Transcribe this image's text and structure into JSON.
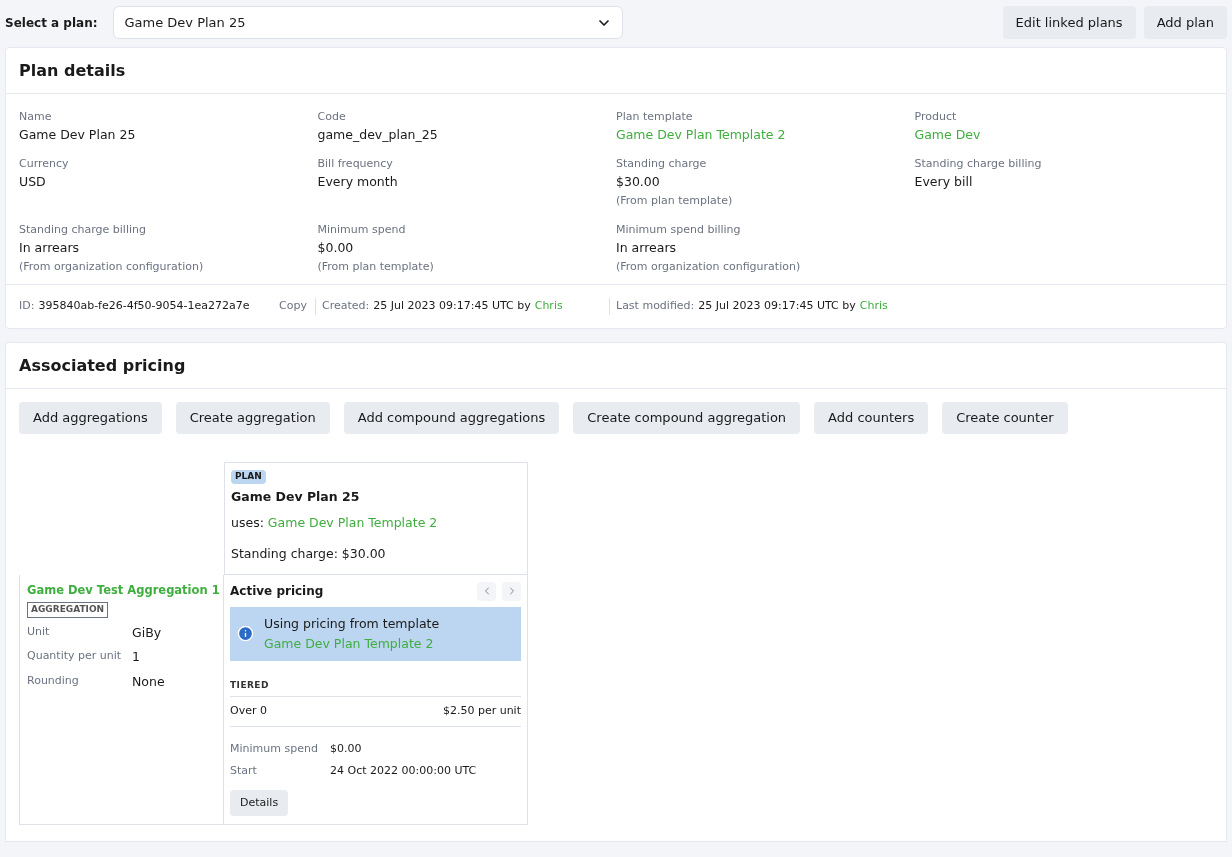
{
  "plan_select": {
    "label": "Select a plan:",
    "value": "Game Dev Plan 25"
  },
  "header_buttons": [
    "Edit linked plans",
    "Add plan"
  ],
  "plan_details": {
    "title": "Plan details",
    "fields": [
      {
        "label": "Name",
        "value": "Game Dev Plan 25",
        "link": false
      },
      {
        "label": "Code",
        "value": "game_dev_plan_25",
        "link": false
      },
      {
        "label": "Plan template",
        "value": "Game Dev Plan Template 2",
        "link": true
      },
      {
        "label": "Product",
        "value": "Game Dev",
        "link": true
      },
      {
        "label": "Currency",
        "value": "USD",
        "link": false
      },
      {
        "label": "Bill frequency",
        "value": "Every month",
        "link": false
      },
      {
        "label": "Standing charge",
        "value": "$30.00",
        "note": "(From plan template)",
        "link": false
      },
      {
        "label": "Standing charge billing",
        "value": "Every bill",
        "link": false
      },
      {
        "label": "Standing charge billing",
        "value": "In arrears",
        "note": "(From organization configuration)",
        "link": false
      },
      {
        "label": "Minimum spend",
        "value": "$0.00",
        "note": "(From plan template)",
        "link": false
      },
      {
        "label": "Minimum spend billing",
        "value": "In arrears",
        "note": "(From organization configuration)",
        "link": false
      }
    ],
    "footer": {
      "id_label": "ID:",
      "id": "395840ab-fe26-4f50-9054-1ea272a7e",
      "copy": "Copy",
      "created_label": "Created:",
      "created": "25 Jul 2023 09:17:45 UTC by",
      "created_by": "Chris",
      "modified_label": "Last modified:",
      "modified": "25 Jul 2023 09:17:45 UTC by",
      "modified_by": "Chris"
    }
  },
  "associated_pricing": {
    "title": "Associated pricing",
    "buttons": [
      "Add aggregations",
      "Create aggregation",
      "Add compound aggregations",
      "Create compound aggregation",
      "Add counters",
      "Create counter"
    ],
    "plan": {
      "badge": "PLAN",
      "name": "Game Dev Plan 25",
      "uses_label": "uses:",
      "uses": "Game Dev Plan Template 2",
      "standing_charge": "Standing charge: $30.00"
    },
    "aggregation": {
      "name": "Game Dev Test Aggregation 1",
      "badge": "AGGREGATION",
      "props": [
        {
          "label": "Unit",
          "value": "GiBy"
        },
        {
          "label": "Quantity per unit",
          "value": "1"
        },
        {
          "label": "Rounding",
          "value": "None"
        }
      ]
    },
    "pricing": {
      "title": "Active pricing",
      "info": "Using pricing from template",
      "info_link": "Game Dev Plan Template 2",
      "type": "TIERED",
      "tiers": [
        {
          "range": "Over 0",
          "price": "$2.50 per unit"
        }
      ],
      "props": [
        {
          "label": "Minimum spend",
          "value": "$0.00"
        },
        {
          "label": "Start",
          "value": "24 Oct 2022 00:00:00 UTC"
        }
      ],
      "details_button": "Details"
    }
  }
}
